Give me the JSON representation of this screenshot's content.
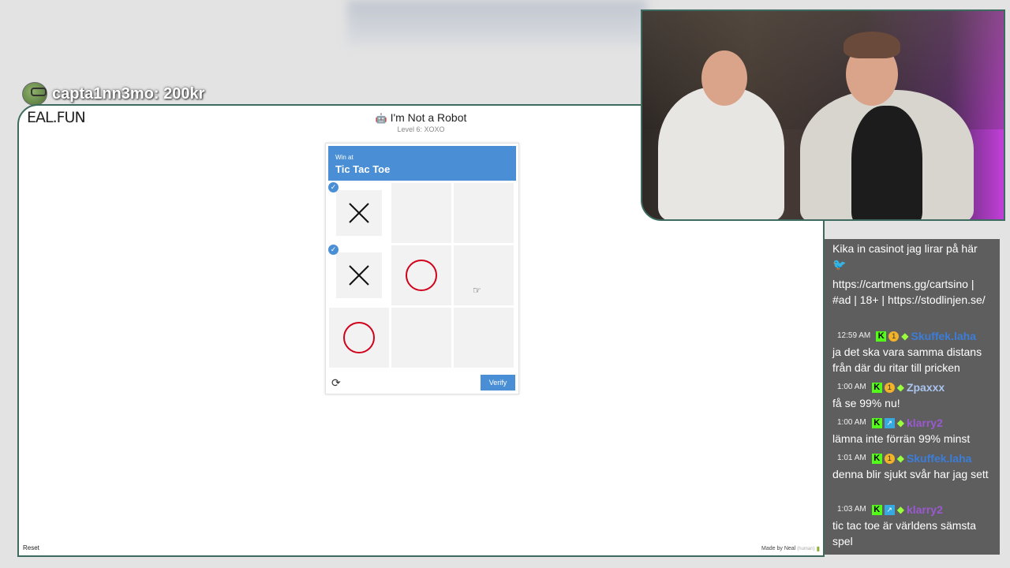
{
  "overlay": {
    "donation": "capta1nn3mo: 200kr"
  },
  "game": {
    "logo": "EAL.FUN",
    "title": "I'm Not a Robot",
    "subtitle": "Level 6: XOXO",
    "captcha": {
      "header_small": "Win at",
      "header_big": "Tic Tac Toe",
      "verify_label": "Verify",
      "cells": [
        {
          "mark": "X",
          "selected": true
        },
        {
          "mark": "",
          "selected": false
        },
        {
          "mark": "",
          "selected": false
        },
        {
          "mark": "X",
          "selected": true
        },
        {
          "mark": "O",
          "selected": false
        },
        {
          "mark": "",
          "selected": false
        },
        {
          "mark": "O",
          "selected": false
        },
        {
          "mark": "",
          "selected": false
        },
        {
          "mark": "",
          "selected": false
        }
      ]
    },
    "reset_label": "Reset",
    "made_by": "Made by Neal",
    "made_by_tag": "(human)"
  },
  "chat": {
    "messages": [
      {
        "time": "",
        "user": "",
        "user_color": "",
        "badges": [],
        "text": "Kika in casinot jag lirar på här"
      },
      {
        "time": "",
        "user": "",
        "user_color": "",
        "badges": [],
        "text": "https://cartmens.gg/cartsino | #ad | 18+ | https://stodlinjen.se/"
      },
      {
        "time": "12:59 AM",
        "user": "Skuffek.laha",
        "user_color": "#3b7dd8",
        "badges": [
          "k",
          "coin",
          "gem"
        ],
        "text": "ja det ska vara samma distans från där du ritar till pricken"
      },
      {
        "time": "1:00 AM",
        "user": "Zpaxxx",
        "user_color": "#a9c4ee",
        "badges": [
          "k",
          "coin",
          "gem"
        ],
        "text": "få se 99% nu!"
      },
      {
        "time": "1:00 AM",
        "user": "klarry2",
        "user_color": "#9b59d0",
        "badges": [
          "k",
          "blue",
          "gem"
        ],
        "text": "lämna inte förrän 99% minst"
      },
      {
        "time": "1:01 AM",
        "user": "Skuffek.laha",
        "user_color": "#3b7dd8",
        "badges": [
          "k",
          "coin",
          "gem"
        ],
        "text": "denna blir sjukt svår har jag sett"
      },
      {
        "time": "1:03 AM",
        "user": "klarry2",
        "user_color": "#9b59d0",
        "badges": [
          "k",
          "blue",
          "gem"
        ],
        "text": "tic tac toe är världens sämsta spel"
      }
    ]
  }
}
